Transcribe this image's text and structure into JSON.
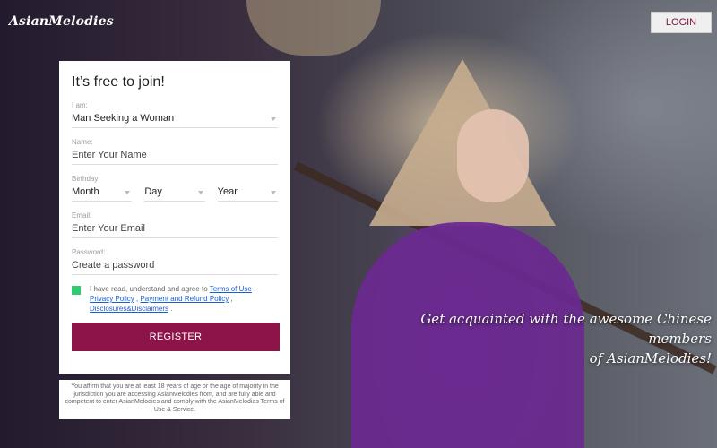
{
  "header": {
    "logo_text": "AsianMelodies",
    "login_label": "LOGIN"
  },
  "form": {
    "title": "It’s free to join!",
    "i_am": {
      "label": "I am:",
      "value": "Man Seeking a Woman"
    },
    "name": {
      "label": "Name:",
      "placeholder": "Enter Your Name"
    },
    "birthday": {
      "label": "Birthday:",
      "month": "Month",
      "day": "Day",
      "year": "Year"
    },
    "email": {
      "label": "Email:",
      "placeholder": "Enter Your Email"
    },
    "password": {
      "label": "Password:",
      "placeholder": "Create a password"
    },
    "consent": {
      "checked": true,
      "text_prefix": "I have read, understand and agree to",
      "terms_link": "Terms of Use",
      "privacy_link": "Privacy Policy",
      "refund_link": "Payment and Refund Policy",
      "disclosures_link": "Disclosures&Disclaimers"
    },
    "register_label": "REGISTER"
  },
  "disclaimer": "You affirm that you are at least 18 years of age or the age of majority in the jurisdiction you are accessing AsianMelodies from, and are fully able and competent to enter AsianMelodies and comply with the AsianMelodies Terms of Use & Service.",
  "hero": {
    "tagline_line1": "Get acquainted with the awesome Chinese members",
    "tagline_line2": "of AsianMelodies!"
  },
  "colors": {
    "accent": "#8c1448",
    "checkbox": "#2ecc71",
    "link": "#1a5fd0"
  }
}
